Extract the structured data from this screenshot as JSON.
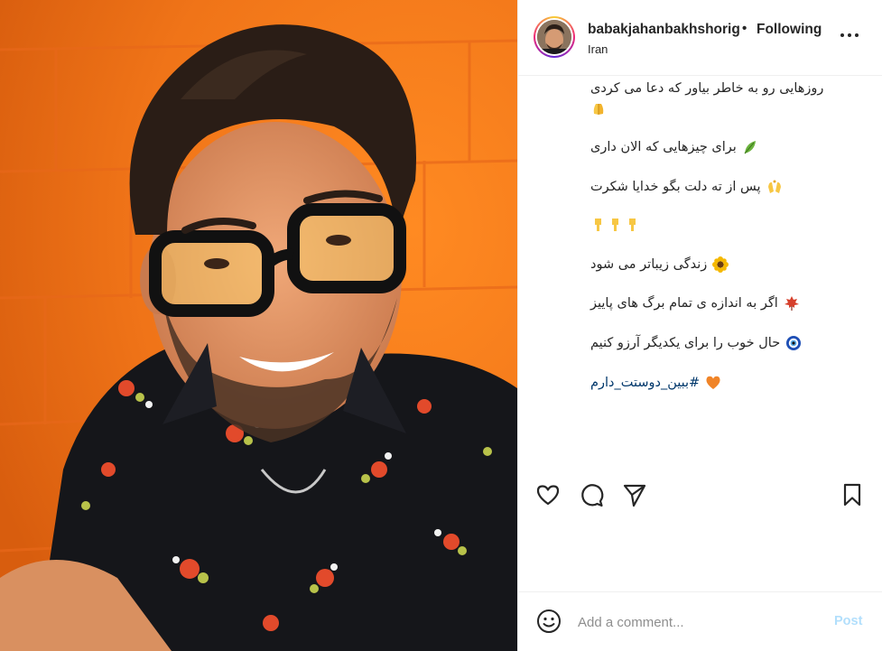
{
  "post": {
    "username": "babakjahanbakhshoriginal",
    "separator": "•",
    "follow_status": "Following",
    "location": "Iran",
    "more_icon": "more-horizontal-icon"
  },
  "caption": {
    "lines": [
      {
        "text": "روزهایی رو به خاطر بیاور که دعا می کردی",
        "emoji": ""
      },
      {
        "text": "",
        "emoji": "praying-hands-icon"
      },
      {
        "text": "برای چیزهایی که الان داری",
        "emoji": "herb-leaf-icon"
      },
      {
        "text": "پس از ته دلت بگو خدایا شکرت",
        "emoji": "raised-hands-icon"
      },
      {
        "text": "",
        "emoji": "pointing-down-icon-x3"
      },
      {
        "text": "زندگی زیباتر می شود",
        "emoji": "sunflower-icon"
      },
      {
        "text": "اگر به اندازه ی تمام برگ های پاییز",
        "emoji": "maple-leaf-icon"
      },
      {
        "text": "حال خوب را برای یکدیگر آرزو کنیم",
        "emoji": "nazar-amulet-icon"
      },
      {
        "text": "#ببین_دوستت_دارم",
        "emoji": "orange-heart-icon"
      }
    ]
  },
  "actions": {
    "like_icon": "heart-icon",
    "comment_icon": "comment-icon",
    "share_icon": "send-icon",
    "save_icon": "bookmark-icon"
  },
  "comment_bar": {
    "emoji_icon": "smiley-icon",
    "placeholder": "Add a comment...",
    "post_label": "Post"
  },
  "colors": {
    "background_photo": "#f07a1e",
    "link": "#00376b",
    "post_button_disabled": "#b2dffc"
  }
}
